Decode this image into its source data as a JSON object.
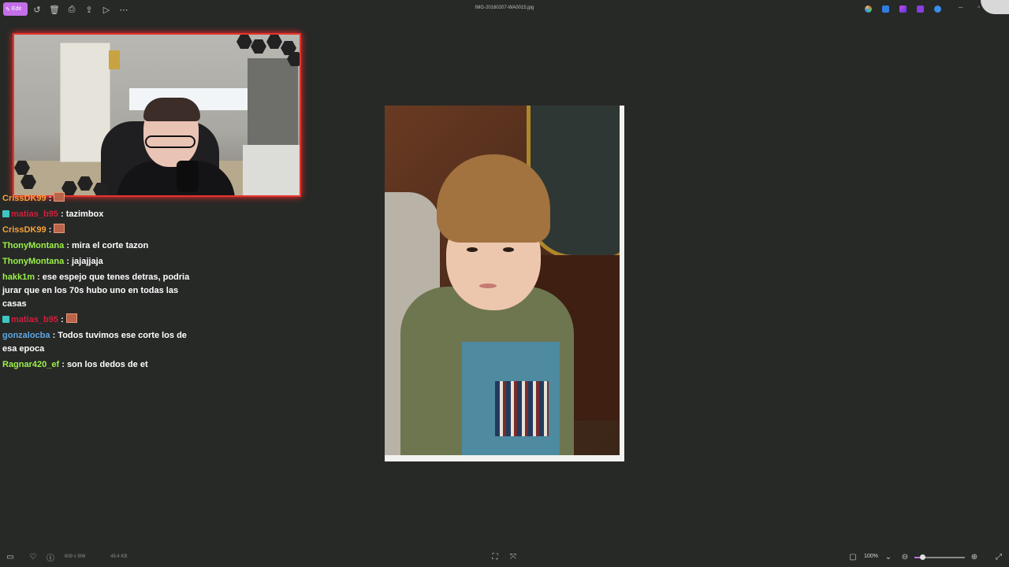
{
  "toolbar": {
    "edit_label": "Edit",
    "title": "IMG-20160207-WA0015.jpg",
    "accent": "#c46ee8"
  },
  "chat": [
    {
      "user": "CrissDK99",
      "color": "#f5a23a",
      "text": "",
      "badge": false,
      "emote": true
    },
    {
      "user": "matias_b95",
      "color": "#d21f3c",
      "text": "tazimbox",
      "badge": true,
      "emote": false
    },
    {
      "user": "CrissDK99",
      "color": "#f5a23a",
      "text": "",
      "badge": false,
      "emote": true
    },
    {
      "user": "ThonyMontana",
      "color": "#9cf04a",
      "text": "mira el corte tazon",
      "badge": false,
      "emote": false
    },
    {
      "user": "ThonyMontana",
      "color": "#9cf04a",
      "text": "jajajjaja",
      "badge": false,
      "emote": false
    },
    {
      "user": "hakk1m",
      "color": "#9cf04a",
      "text": "ese espejo que tenes detras, podria jurar que en los 70s hubo uno en todas las casas",
      "badge": false,
      "emote": false
    },
    {
      "user": "matias_b95",
      "color": "#d21f3c",
      "text": "",
      "badge": true,
      "emote": true
    },
    {
      "user": "gonzalocba",
      "color": "#5fa8e6",
      "text": "Todos tuvimos ese corte los de esa epoca",
      "badge": false,
      "emote": false
    },
    {
      "user": "Ragnar420_ef",
      "color": "#9cf04a",
      "text": "son los dedos de et",
      "badge": false,
      "emote": false
    }
  ],
  "statusbar": {
    "dimensions": "609 x 906",
    "filesize": "49.4 KB",
    "zoom": "100%",
    "zoom_fraction": 0.15
  }
}
